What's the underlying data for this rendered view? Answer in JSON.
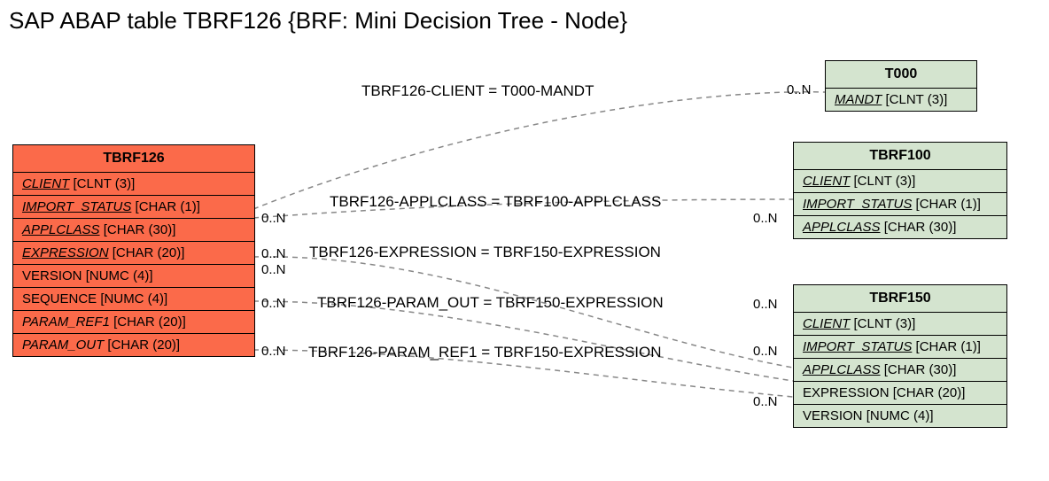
{
  "title": "SAP ABAP table TBRF126 {BRF: Mini Decision Tree - Node}",
  "main": {
    "name": "TBRF126",
    "fields": [
      {
        "name": "CLIENT",
        "type": "[CLNT (3)]",
        "ul": true
      },
      {
        "name": "IMPORT_STATUS",
        "type": "[CHAR (1)]",
        "ul": true
      },
      {
        "name": "APPLCLASS",
        "type": "[CHAR (30)]",
        "ul": true
      },
      {
        "name": "EXPRESSION",
        "type": "[CHAR (20)]",
        "ul": true
      },
      {
        "name": "VERSION",
        "type": "[NUMC (4)]",
        "ul": false
      },
      {
        "name": "SEQUENCE",
        "type": "[NUMC (4)]",
        "ul": false
      },
      {
        "name": "PARAM_REF1",
        "type": "[CHAR (20)]",
        "ul": false
      },
      {
        "name": "PARAM_OUT",
        "type": "[CHAR (20)]",
        "ul": false
      }
    ]
  },
  "t000": {
    "name": "T000",
    "fields": [
      {
        "name": "MANDT",
        "type": "[CLNT (3)]",
        "ul": true
      }
    ]
  },
  "t100": {
    "name": "TBRF100",
    "fields": [
      {
        "name": "CLIENT",
        "type": "[CLNT (3)]",
        "ul": true
      },
      {
        "name": "IMPORT_STATUS",
        "type": "[CHAR (1)]",
        "ul": true
      },
      {
        "name": "APPLCLASS",
        "type": "[CHAR (30)]",
        "ul": true
      }
    ]
  },
  "t150": {
    "name": "TBRF150",
    "fields": [
      {
        "name": "CLIENT",
        "type": "[CLNT (3)]",
        "ul": true
      },
      {
        "name": "IMPORT_STATUS",
        "type": "[CHAR (1)]",
        "ul": true
      },
      {
        "name": "APPLCLASS",
        "type": "[CHAR (30)]",
        "ul": true
      },
      {
        "name": "EXPRESSION",
        "type": "[CHAR (20)]",
        "ul": false
      },
      {
        "name": "VERSION",
        "type": "[NUMC (4)]",
        "ul": false
      }
    ]
  },
  "rels": {
    "r1": "TBRF126-CLIENT = T000-MANDT",
    "r2": "TBRF126-APPLCLASS = TBRF100-APPLCLASS",
    "r3": "TBRF126-EXPRESSION = TBRF150-EXPRESSION",
    "r4": "TBRF126-PARAM_OUT = TBRF150-EXPRESSION",
    "r5": "TBRF126-PARAM_REF1 = TBRF150-EXPRESSION"
  },
  "card": "0..N"
}
